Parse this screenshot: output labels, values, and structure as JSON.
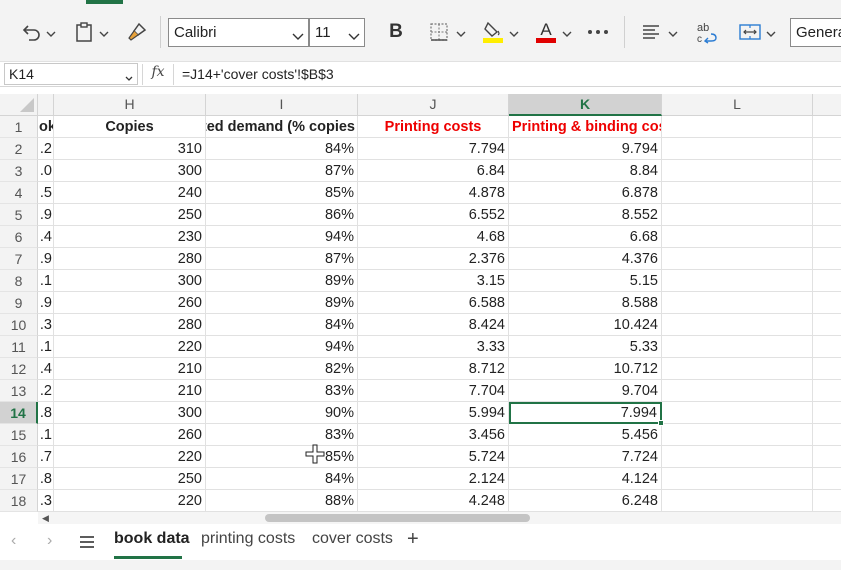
{
  "ribbon": {
    "font_name": "Calibri",
    "font_size": "11",
    "number_format": "Genera",
    "font_color": "#e00000",
    "highlight_color": "#ffee00"
  },
  "formula_bar": {
    "name_box": "K14",
    "fx_label": "fx",
    "formula": "=J14+'cover costs'!$B$3"
  },
  "columns": [
    "H",
    "I",
    "J",
    "K",
    "L"
  ],
  "selected_column": "K",
  "selected_row": "14",
  "headers": {
    "g": "ok",
    "h": "Copies",
    "i": "ated demand (% copies",
    "j": "Printing costs",
    "k": "Printing & binding costs"
  },
  "rows": [
    {
      "n": "1"
    },
    {
      "n": "2",
      "g": ".2",
      "h": "310",
      "i": "84%",
      "j": "7.794",
      "k": "9.794"
    },
    {
      "n": "3",
      "g": ".0",
      "h": "300",
      "i": "87%",
      "j": "6.84",
      "k": "8.84"
    },
    {
      "n": "4",
      "g": ".5",
      "h": "240",
      "i": "85%",
      "j": "4.878",
      "k": "6.878"
    },
    {
      "n": "5",
      "g": ".9",
      "h": "250",
      "i": "86%",
      "j": "6.552",
      "k": "8.552"
    },
    {
      "n": "6",
      "g": ".4",
      "h": "230",
      "i": "94%",
      "j": "4.68",
      "k": "6.68"
    },
    {
      "n": "7",
      "g": ".9",
      "h": "280",
      "i": "87%",
      "j": "2.376",
      "k": "4.376"
    },
    {
      "n": "8",
      "g": ".1",
      "h": "300",
      "i": "89%",
      "j": "3.15",
      "k": "5.15"
    },
    {
      "n": "9",
      "g": ".9",
      "h": "260",
      "i": "89%",
      "j": "6.588",
      "k": "8.588"
    },
    {
      "n": "10",
      "g": ".3",
      "h": "280",
      "i": "84%",
      "j": "8.424",
      "k": "10.424"
    },
    {
      "n": "11",
      "g": ".1",
      "h": "220",
      "i": "94%",
      "j": "3.33",
      "k": "5.33"
    },
    {
      "n": "12",
      "g": ".4",
      "h": "210",
      "i": "82%",
      "j": "8.712",
      "k": "10.712"
    },
    {
      "n": "13",
      "g": ".2",
      "h": "210",
      "i": "83%",
      "j": "7.704",
      "k": "9.704"
    },
    {
      "n": "14",
      "g": ".8",
      "h": "300",
      "i": "90%",
      "j": "5.994",
      "k": "7.994"
    },
    {
      "n": "15",
      "g": ".1",
      "h": "260",
      "i": "83%",
      "j": "3.456",
      "k": "5.456"
    },
    {
      "n": "16",
      "g": ".7",
      "h": "220",
      "i": "85%",
      "j": "5.724",
      "k": "7.724"
    },
    {
      "n": "17",
      "g": ".8",
      "h": "250",
      "i": "84%",
      "j": "2.124",
      "k": "4.124"
    },
    {
      "n": "18",
      "g": ".3",
      "h": "220",
      "i": "88%",
      "j": "4.248",
      "k": "6.248"
    }
  ],
  "sheets": [
    {
      "label": "book data",
      "active": true
    },
    {
      "label": "printing costs",
      "active": false
    },
    {
      "label": "cover costs",
      "active": false
    }
  ],
  "add_sheet_label": "+"
}
